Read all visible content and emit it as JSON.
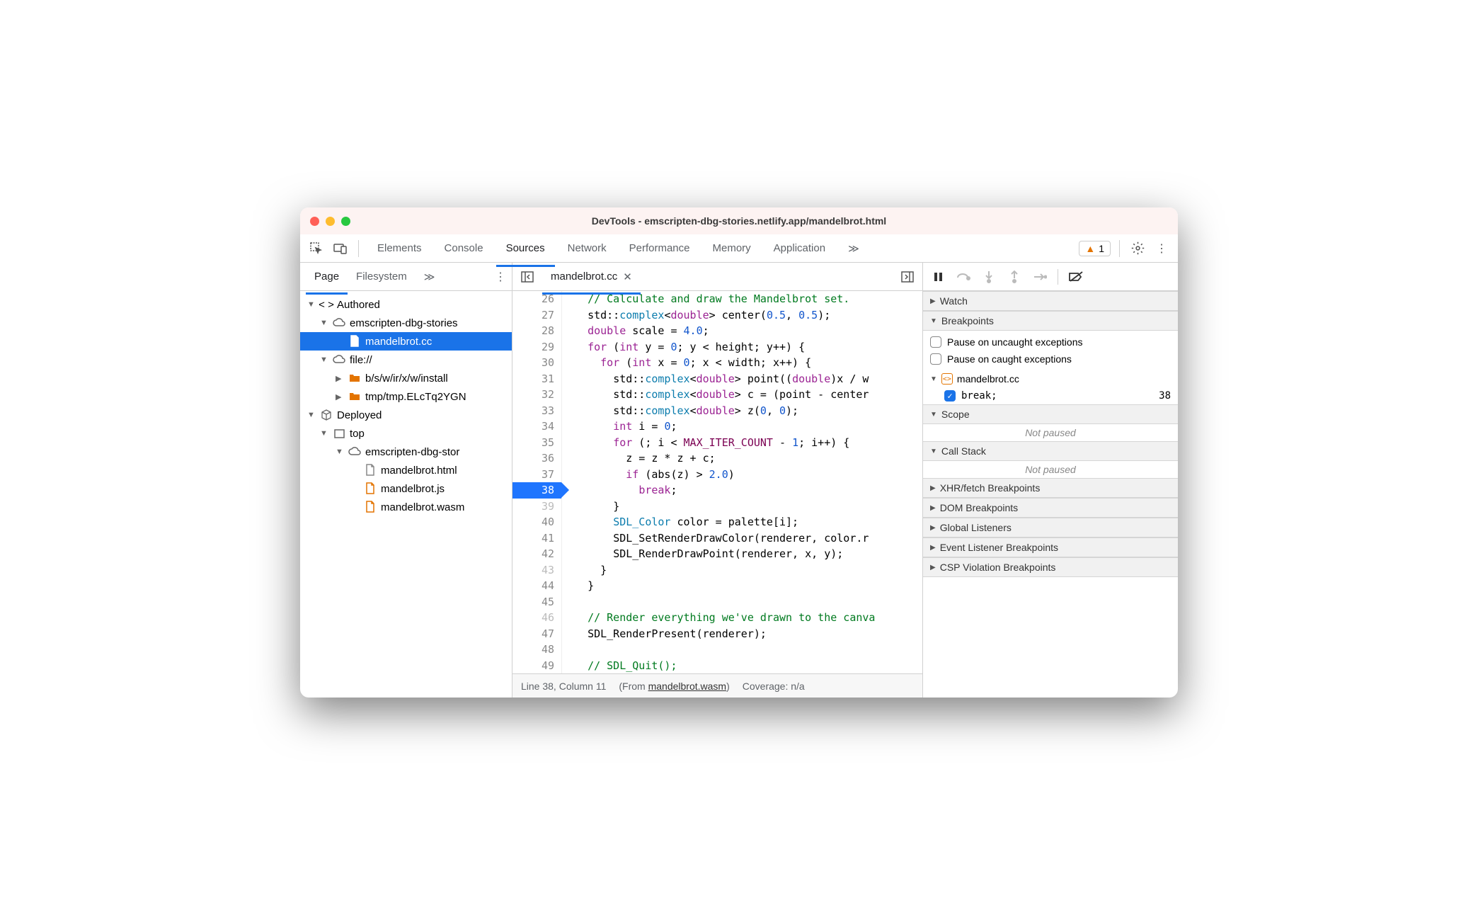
{
  "window": {
    "title": "DevTools - emscripten-dbg-stories.netlify.app/mandelbrot.html"
  },
  "warnings": {
    "count": "1"
  },
  "mainTabs": {
    "elements": "Elements",
    "console": "Console",
    "sources": "Sources",
    "network": "Network",
    "performance": "Performance",
    "memory": "Memory",
    "application": "Application"
  },
  "navTabs": {
    "page": "Page",
    "filesystem": "Filesystem"
  },
  "tree": {
    "authored": "Authored",
    "domainA": "emscripten-dbg-stories",
    "fileA": "mandelbrot.cc",
    "fileScheme": "file://",
    "folder1": "b/s/w/ir/x/w/install",
    "folder2": "tmp/tmp.ELcTq2YGN",
    "deployed": "Deployed",
    "top": "top",
    "domainB": "emscripten-dbg-stor",
    "html": "mandelbrot.html",
    "js": "mandelbrot.js",
    "wasm": "mandelbrot.wasm"
  },
  "fileTab": {
    "name": "mandelbrot.cc"
  },
  "code": {
    "lines": [
      {
        "n": "26",
        "indent": 1,
        "tokens": [
          [
            "comment",
            "// Calculate and draw the Mandelbrot set."
          ]
        ]
      },
      {
        "n": "27",
        "indent": 1,
        "tokens": [
          [
            "plain",
            "std::"
          ],
          [
            "type",
            "complex"
          ],
          [
            "plain",
            "<"
          ],
          [
            "kw",
            "double"
          ],
          [
            "plain",
            "> center("
          ],
          [
            "num",
            "0.5"
          ],
          [
            "plain",
            ", "
          ],
          [
            "num",
            "0.5"
          ],
          [
            "plain",
            ");"
          ]
        ]
      },
      {
        "n": "28",
        "indent": 1,
        "tokens": [
          [
            "kw",
            "double"
          ],
          [
            "plain",
            " scale = "
          ],
          [
            "num",
            "4.0"
          ],
          [
            "plain",
            ";"
          ]
        ]
      },
      {
        "n": "29",
        "indent": 1,
        "tokens": [
          [
            "kw",
            "for"
          ],
          [
            "plain",
            " ("
          ],
          [
            "kw",
            "int"
          ],
          [
            "plain",
            " y = "
          ],
          [
            "num",
            "0"
          ],
          [
            "plain",
            "; y < height; y++) {"
          ]
        ]
      },
      {
        "n": "30",
        "indent": 2,
        "tokens": [
          [
            "kw",
            "for"
          ],
          [
            "plain",
            " ("
          ],
          [
            "kw",
            "int"
          ],
          [
            "plain",
            " x = "
          ],
          [
            "num",
            "0"
          ],
          [
            "plain",
            "; x < width; x++) {"
          ]
        ]
      },
      {
        "n": "31",
        "indent": 3,
        "tokens": [
          [
            "plain",
            "std::"
          ],
          [
            "type",
            "complex"
          ],
          [
            "plain",
            "<"
          ],
          [
            "kw",
            "double"
          ],
          [
            "plain",
            "> point(("
          ],
          [
            "kw",
            "double"
          ],
          [
            "plain",
            ")x / w"
          ]
        ]
      },
      {
        "n": "32",
        "indent": 3,
        "tokens": [
          [
            "plain",
            "std::"
          ],
          [
            "type",
            "complex"
          ],
          [
            "plain",
            "<"
          ],
          [
            "kw",
            "double"
          ],
          [
            "plain",
            "> c = (point - center"
          ]
        ]
      },
      {
        "n": "33",
        "indent": 3,
        "tokens": [
          [
            "plain",
            "std::"
          ],
          [
            "type",
            "complex"
          ],
          [
            "plain",
            "<"
          ],
          [
            "kw",
            "double"
          ],
          [
            "plain",
            "> z("
          ],
          [
            "num",
            "0"
          ],
          [
            "plain",
            ", "
          ],
          [
            "num",
            "0"
          ],
          [
            "plain",
            ");"
          ]
        ]
      },
      {
        "n": "34",
        "indent": 3,
        "tokens": [
          [
            "kw",
            "int"
          ],
          [
            "plain",
            " i = "
          ],
          [
            "num",
            "0"
          ],
          [
            "plain",
            ";"
          ]
        ]
      },
      {
        "n": "35",
        "indent": 3,
        "tokens": [
          [
            "kw",
            "for"
          ],
          [
            "plain",
            " (; i < "
          ],
          [
            "const",
            "MAX_ITER_COUNT"
          ],
          [
            "plain",
            " - "
          ],
          [
            "num",
            "1"
          ],
          [
            "plain",
            "; i++) {"
          ]
        ]
      },
      {
        "n": "36",
        "indent": 4,
        "tokens": [
          [
            "plain",
            "z = z * z + c;"
          ]
        ]
      },
      {
        "n": "37",
        "indent": 4,
        "tokens": [
          [
            "kw",
            "if"
          ],
          [
            "plain",
            " (abs(z) > "
          ],
          [
            "num",
            "2.0"
          ],
          [
            "plain",
            ")"
          ]
        ]
      },
      {
        "n": "38",
        "bp": true,
        "indent": 5,
        "tokens": [
          [
            "kw",
            "break"
          ],
          [
            "plain",
            ";"
          ]
        ]
      },
      {
        "n": "39",
        "dim": true,
        "indent": 3,
        "tokens": [
          [
            "plain",
            "}"
          ]
        ]
      },
      {
        "n": "40",
        "indent": 3,
        "tokens": [
          [
            "type",
            "SDL_Color"
          ],
          [
            "plain",
            " color = palette[i];"
          ]
        ]
      },
      {
        "n": "41",
        "indent": 3,
        "tokens": [
          [
            "plain",
            "SDL_SetRenderDrawColor(renderer, color.r"
          ]
        ]
      },
      {
        "n": "42",
        "indent": 3,
        "tokens": [
          [
            "plain",
            "SDL_RenderDrawPoint(renderer, x, y);"
          ]
        ]
      },
      {
        "n": "43",
        "dim": true,
        "indent": 2,
        "tokens": [
          [
            "plain",
            "}"
          ]
        ]
      },
      {
        "n": "44",
        "indent": 1,
        "tokens": [
          [
            "plain",
            "}"
          ]
        ]
      },
      {
        "n": "45",
        "indent": 0,
        "tokens": []
      },
      {
        "n": "46",
        "dim": true,
        "indent": 1,
        "tokens": [
          [
            "comment",
            "// Render everything we've drawn to the canva"
          ]
        ]
      },
      {
        "n": "47",
        "indent": 1,
        "tokens": [
          [
            "plain",
            "SDL_RenderPresent(renderer);"
          ]
        ]
      },
      {
        "n": "48",
        "indent": 0,
        "tokens": []
      },
      {
        "n": "49",
        "indent": 1,
        "tokens": [
          [
            "comment",
            "// SDL_Quit();"
          ]
        ]
      }
    ]
  },
  "status": {
    "pos": "Line 38, Column 11",
    "fromPrefix": "(From ",
    "fromFile": "mandelbrot.wasm",
    "fromSuffix": ")",
    "coverage": "Coverage: n/a"
  },
  "debugger": {
    "watch": "Watch",
    "breakpoints": "Breakpoints",
    "uncaught": "Pause on uncaught exceptions",
    "caught": "Pause on caught exceptions",
    "bpFile": "mandelbrot.cc",
    "bpCode": "break;",
    "bpLine": "38",
    "scope": "Scope",
    "notPaused": "Not paused",
    "callstack": "Call Stack",
    "xhr": "XHR/fetch Breakpoints",
    "dom": "DOM Breakpoints",
    "global": "Global Listeners",
    "event": "Event Listener Breakpoints",
    "csp": "CSP Violation Breakpoints"
  }
}
